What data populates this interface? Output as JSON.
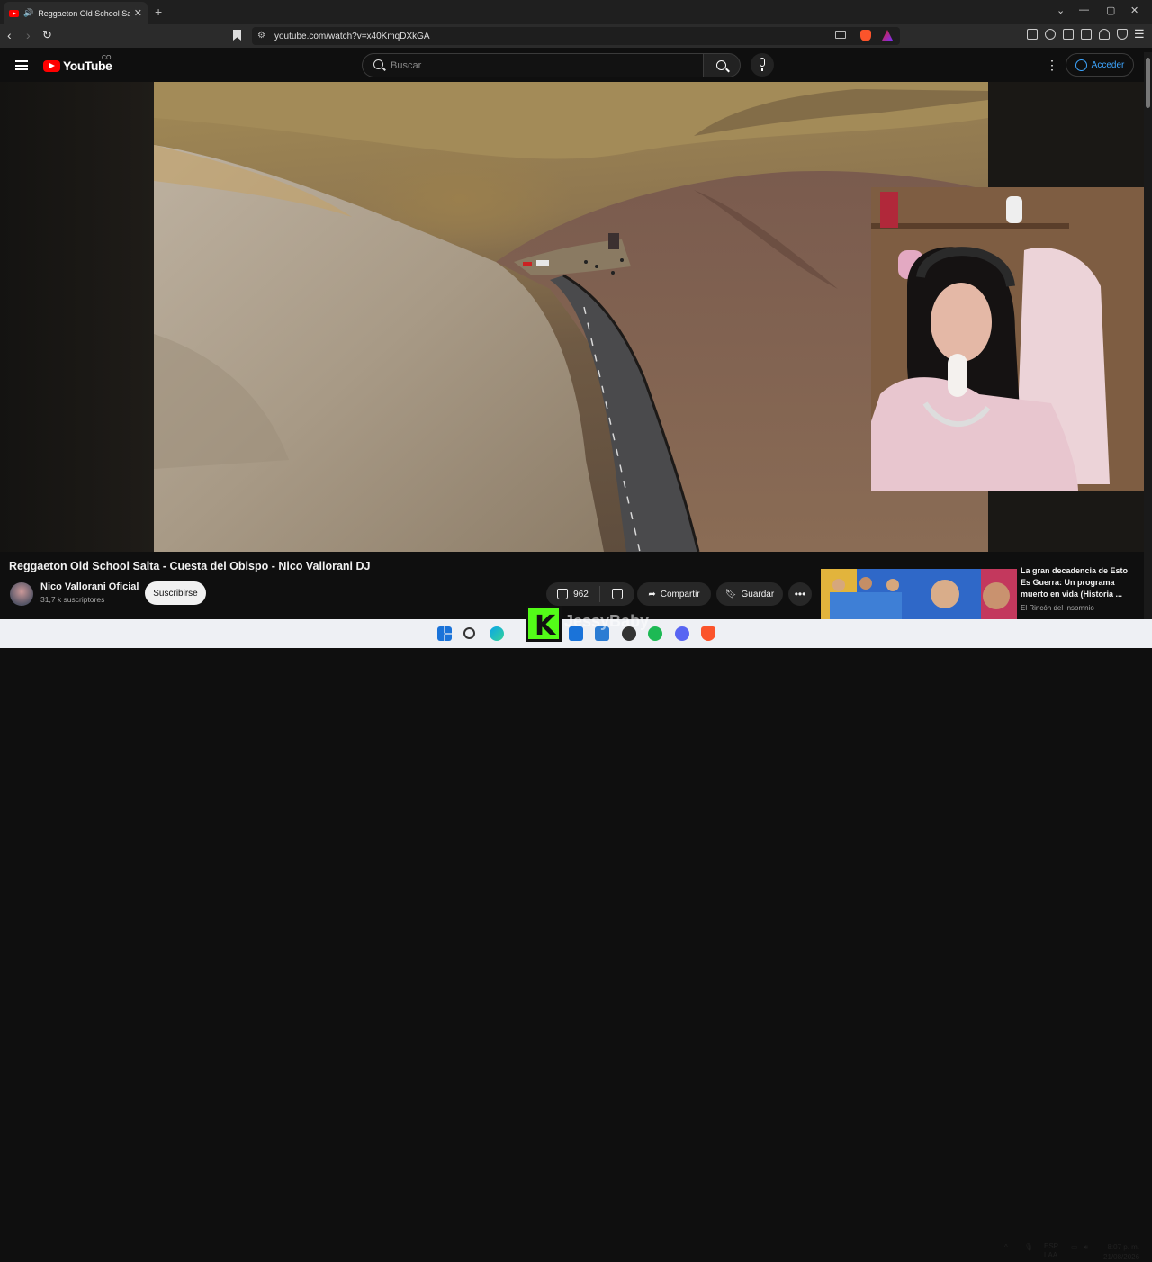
{
  "browser": {
    "tab_title": "Reggaeton Old School Salta",
    "url": "youtube.com/watch?v=x40KmqDXkGA"
  },
  "youtube": {
    "logo_text": "YouTube",
    "country_code": "CO",
    "search_placeholder": "Buscar",
    "signin_label": "Acceder"
  },
  "video": {
    "title": "Reggaeton Old School Salta - Cuesta del Obispo - Nico Vallorani DJ",
    "channel_name": "Nico Vallorani Oficial",
    "subscribers": "31,7 k suscriptores",
    "subscribe_label": "Suscribirse",
    "likes": "962",
    "share_label": "Compartir",
    "save_label": "Guardar"
  },
  "recommendation": {
    "title": "La gran decadencia de Esto Es Guerra: Un programa muerto en vida (Historia ...",
    "channel": "El Rincón del Insomnio"
  },
  "overlay": {
    "kick_letter": "K",
    "streamer_name": "JessyBaby"
  },
  "taskbar": {
    "lang_top": "ESP",
    "lang_bottom": "LAA",
    "time": "8:07 p. m.",
    "date": "21/08/2026"
  },
  "colors": {
    "youtube_red": "#ff0000",
    "link_blue": "#3ea6ff",
    "kick_green": "#53fc18"
  }
}
